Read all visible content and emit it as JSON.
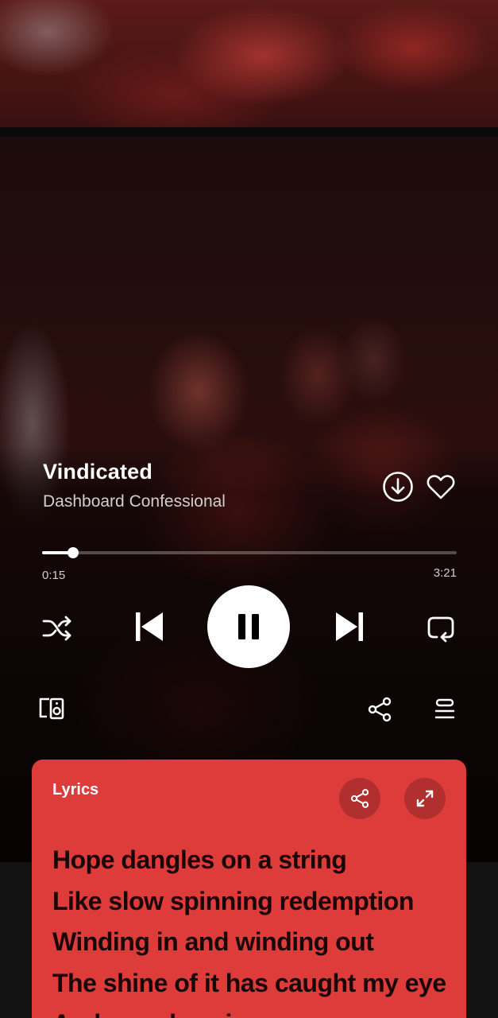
{
  "track": {
    "title": "Vindicated",
    "artist": "Dashboard Confessional"
  },
  "playback": {
    "elapsed": "0:15",
    "duration": "3:21",
    "progress_fraction": 0.075,
    "state": "playing"
  },
  "icons": {
    "download": "download-circle-icon",
    "like": "heart-outline-icon",
    "shuffle": "shuffle-icon",
    "previous": "skip-previous-icon",
    "pause": "pause-icon",
    "next": "skip-next-icon",
    "repeat": "repeat-icon",
    "devices": "connect-devices-icon",
    "share": "share-icon",
    "queue": "queue-icon",
    "expand": "expand-icon"
  },
  "lyrics": {
    "heading": "Lyrics",
    "lines": [
      "Hope dangles on a string",
      "Like slow spinning redemption",
      "Winding in and winding out",
      "The shine of it has caught my eye",
      "And roped me in"
    ]
  },
  "colors": {
    "lyrics_card": "#de3b3b",
    "lyrics_text": "#1a0606",
    "accent_white": "#ffffff"
  }
}
